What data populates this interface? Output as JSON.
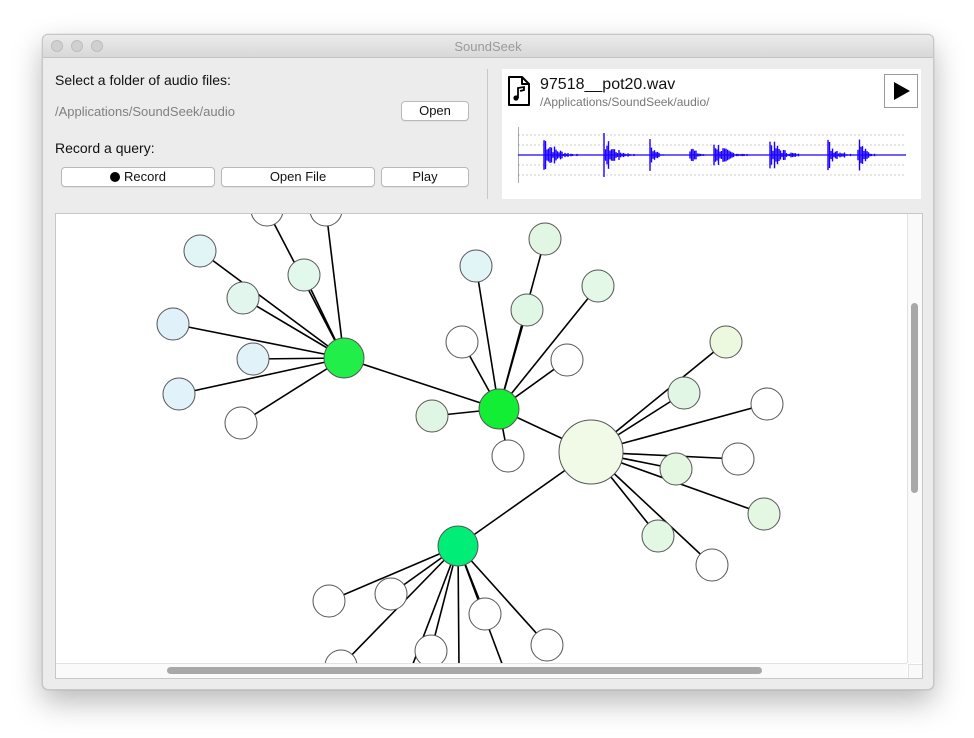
{
  "window": {
    "title": "SoundSeek"
  },
  "folder": {
    "prompt": "Select a folder of audio files:",
    "path": "/Applications/SoundSeek/audio",
    "open_label": "Open"
  },
  "query": {
    "prompt": "Record a query:",
    "record_label": "Record",
    "open_file_label": "Open File",
    "play_label": "Play"
  },
  "player": {
    "filename": "97518__pot20.wav",
    "path": "/Applications/SoundSeek/audio/",
    "file_icon": "music-file-icon",
    "play_icon": "play-icon",
    "waveform_color": "#1a00ff"
  },
  "graph": {
    "colors": {
      "edge": "#000000",
      "node_border": "#4a4a4a"
    },
    "nodes": [
      {
        "id": "hub-a",
        "color": "#22ee4a",
        "role": "hub"
      },
      {
        "id": "hub-b",
        "color": "#11ee33",
        "role": "hub"
      },
      {
        "id": "hub-c",
        "color": "#f0fae6",
        "role": "center"
      },
      {
        "id": "hub-d",
        "color": "#00ee77",
        "role": "hub"
      }
    ]
  }
}
